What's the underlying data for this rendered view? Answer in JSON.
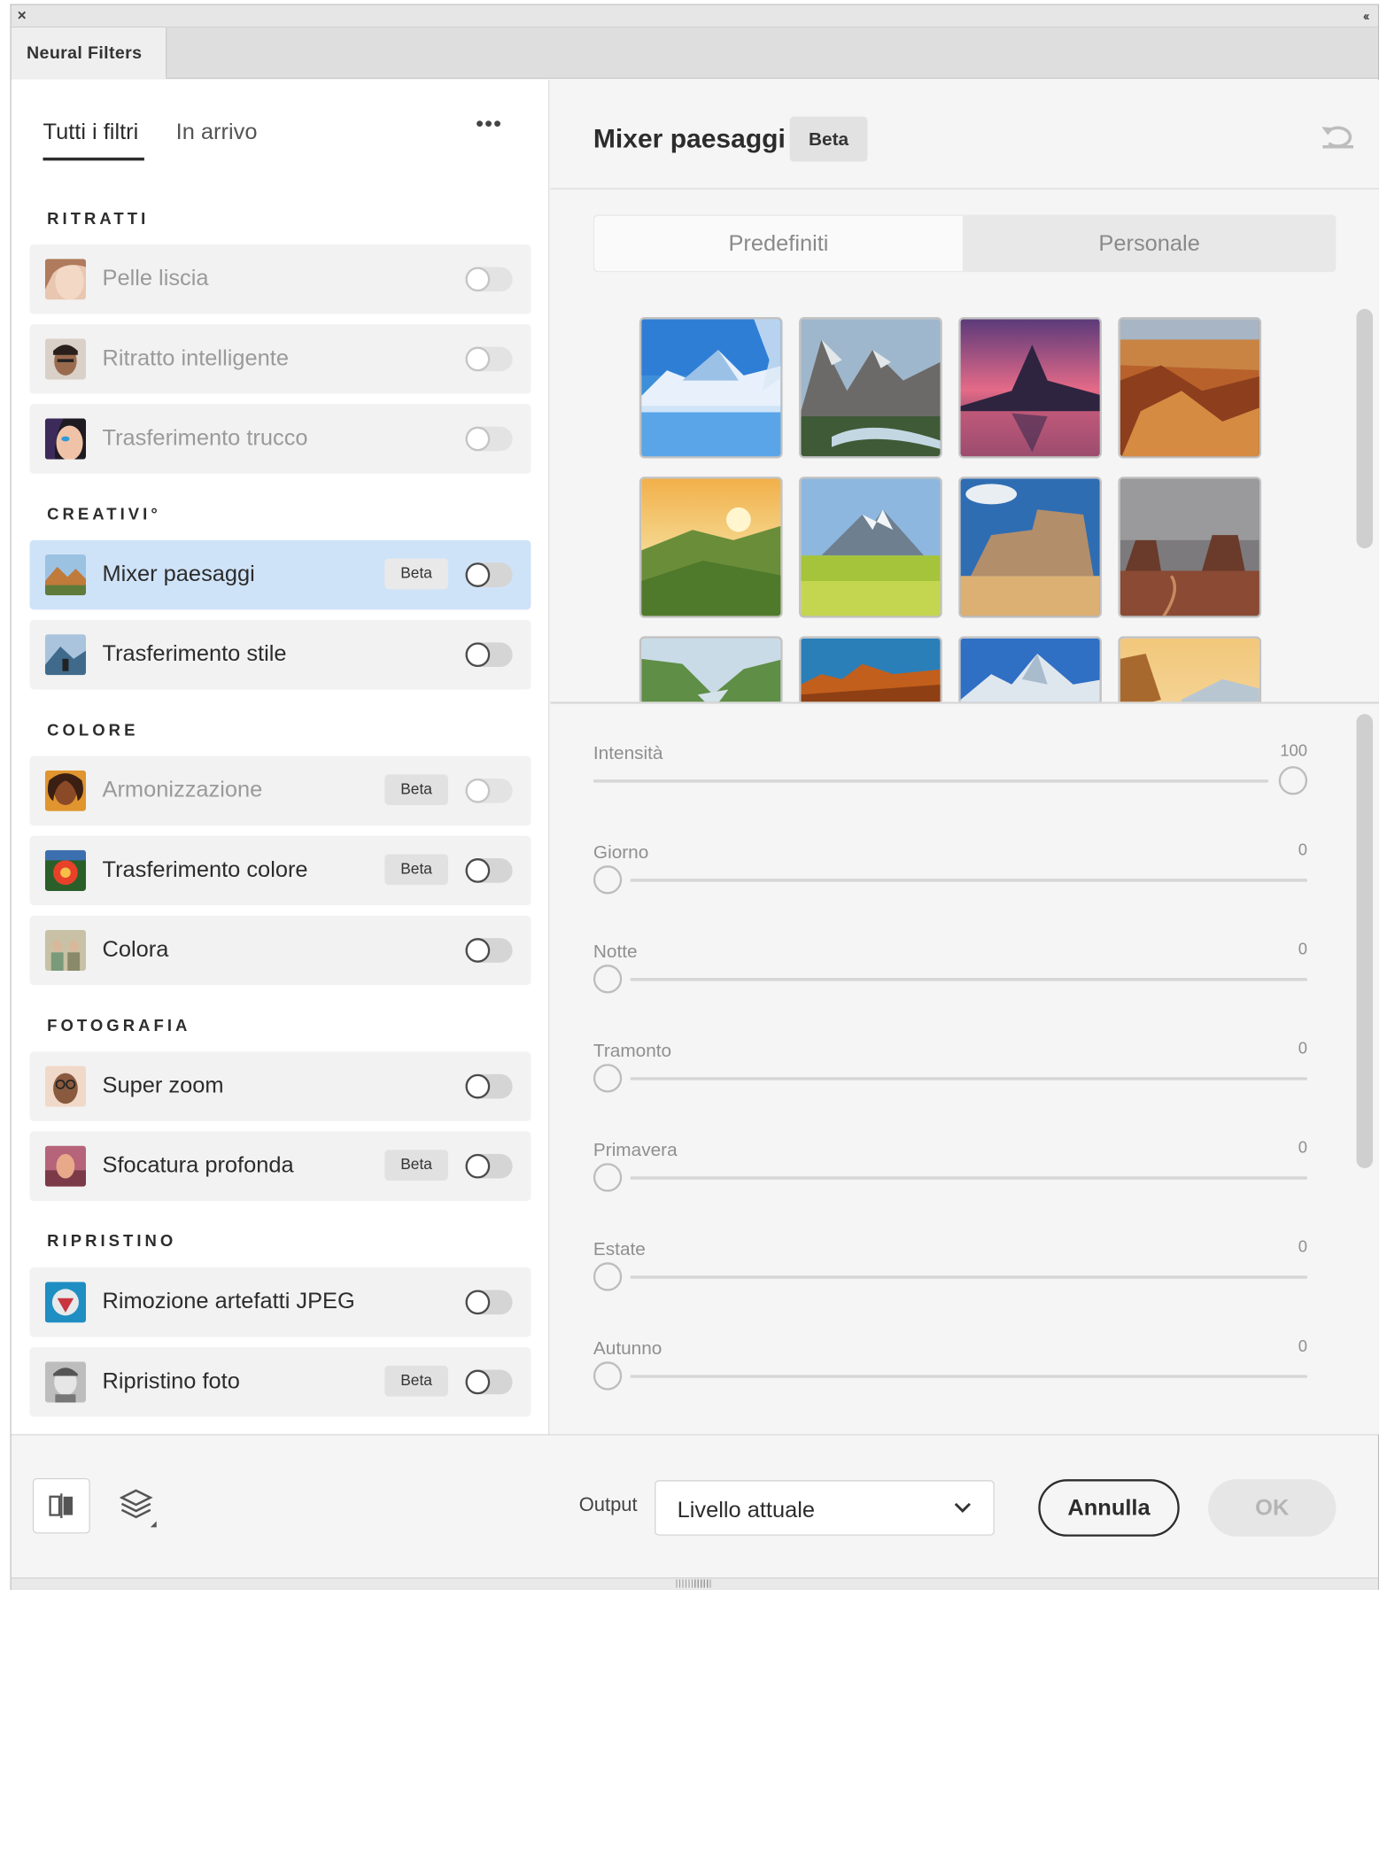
{
  "window": {
    "close_icon": "close-icon",
    "collapse_icon": "double-chevron-left-icon",
    "collapse_glyph": "‹‹",
    "close_glyph": "×",
    "panel_title": "Neural Filters"
  },
  "filter_tabs": {
    "all": "Tutti i filtri",
    "upcoming": "In arrivo",
    "more": "•••",
    "more_icon": "more-icon"
  },
  "categories": {
    "portraits": "RITRATTI",
    "creative": "CREATIVI°",
    "color": "COLORE",
    "photography": "FOTOGRAFIA",
    "restoration": "RIPRISTINO"
  },
  "filters": [
    {
      "label": "Pelle liscia",
      "beta": "",
      "enabled": false,
      "selected": false,
      "dimmed": true
    },
    {
      "label": "Ritratto intelligente",
      "beta": "",
      "enabled": false,
      "selected": false,
      "dimmed": true
    },
    {
      "label": "Trasferimento trucco",
      "beta": "",
      "enabled": false,
      "selected": false,
      "dimmed": true
    },
    {
      "label": "Mixer paesaggi",
      "beta": "Beta",
      "enabled": false,
      "selected": true,
      "dimmed": false
    },
    {
      "label": "Trasferimento stile",
      "beta": "",
      "enabled": false,
      "selected": false,
      "dimmed": false
    },
    {
      "label": "Armonizzazione",
      "beta": "Beta",
      "enabled": false,
      "selected": false,
      "dimmed": true
    },
    {
      "label": "Trasferimento colore",
      "beta": "Beta",
      "enabled": false,
      "selected": false,
      "dimmed": false
    },
    {
      "label": "Colora",
      "beta": "",
      "enabled": false,
      "selected": false,
      "dimmed": false
    },
    {
      "label": "Super zoom",
      "beta": "",
      "enabled": false,
      "selected": false,
      "dimmed": false
    },
    {
      "label": "Sfocatura profonda",
      "beta": "Beta",
      "enabled": false,
      "selected": false,
      "dimmed": false
    },
    {
      "label": "Rimozione artefatti JPEG",
      "beta": "",
      "enabled": false,
      "selected": false,
      "dimmed": false
    },
    {
      "label": "Ripristino foto",
      "beta": "Beta",
      "enabled": false,
      "selected": false,
      "dimmed": false
    }
  ],
  "detail": {
    "title": "Mixer paesaggi",
    "beta": "Beta",
    "reset_icon": "undo-icon",
    "segments": {
      "presets": "Predefiniti",
      "custom": "Personale",
      "active": "presets"
    }
  },
  "sliders": [
    {
      "label": "Intensità",
      "value": "100",
      "fraction": 1.0
    },
    {
      "label": "Giorno",
      "value": "0",
      "fraction": 0.0
    },
    {
      "label": "Notte",
      "value": "0",
      "fraction": 0.0
    },
    {
      "label": "Tramonto",
      "value": "0",
      "fraction": 0.0
    },
    {
      "label": "Primavera",
      "value": "0",
      "fraction": 0.0
    },
    {
      "label": "Estate",
      "value": "0",
      "fraction": 0.0
    },
    {
      "label": "Autunno",
      "value": "0",
      "fraction": 0.0
    }
  ],
  "footer": {
    "compare_icon": "split-view-icon",
    "layers_icon": "layers-icon",
    "output_label": "Output",
    "output_value": "Livello attuale",
    "output_chevron_icon": "chevron-down-icon",
    "cancel": "Annulla",
    "ok": "OK"
  },
  "colors": {
    "selected_row": "#cfe3f8",
    "panel_bg": "#f5f5f5",
    "text": "#2c2c2c",
    "muted_text": "#9a9a9a"
  }
}
